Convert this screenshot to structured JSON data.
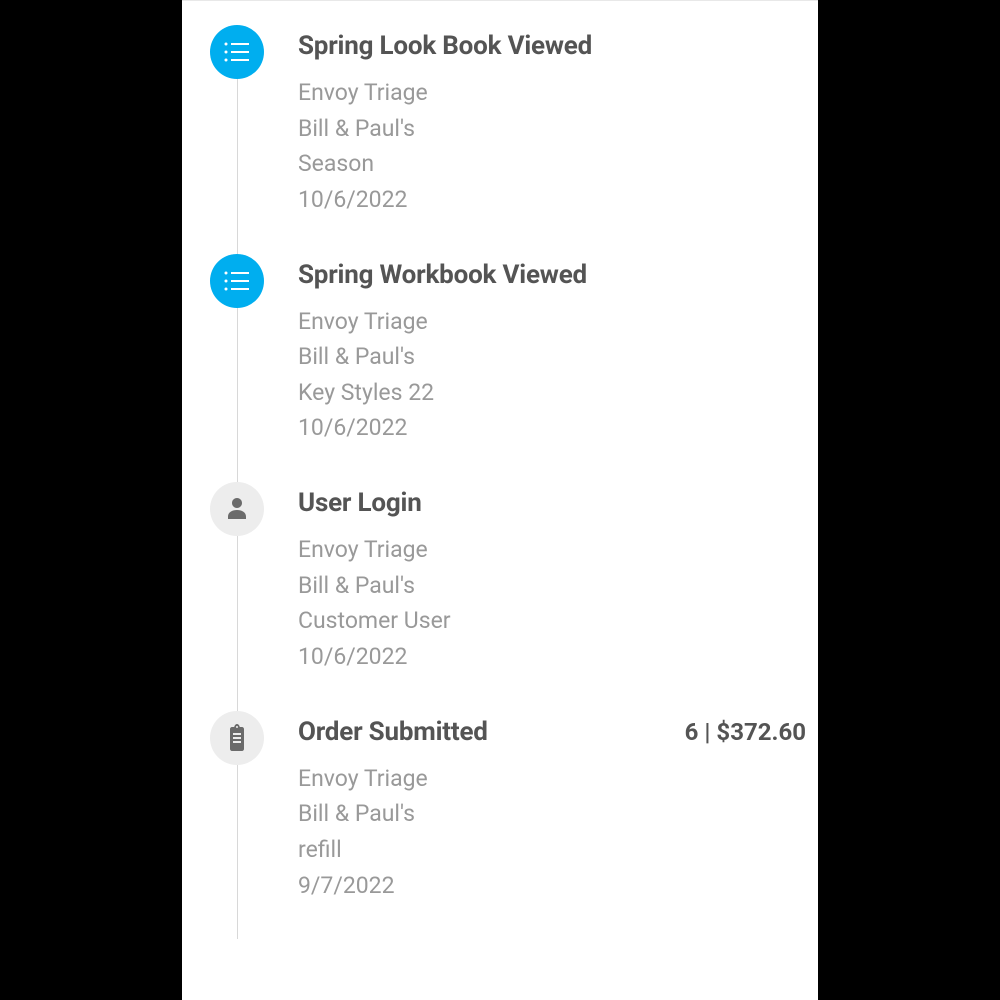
{
  "timeline": [
    {
      "iconType": "list",
      "iconColor": "blue",
      "title": "Spring Look Book Viewed",
      "meta": "",
      "lines": [
        "Envoy Triage",
        "Bill & Paul's",
        "Season",
        "10/6/2022"
      ]
    },
    {
      "iconType": "list",
      "iconColor": "blue",
      "title": "Spring Workbook Viewed",
      "meta": "",
      "lines": [
        "Envoy Triage",
        "Bill & Paul's",
        "Key Styles  22",
        "10/6/2022"
      ]
    },
    {
      "iconType": "user",
      "iconColor": "gray",
      "title": "User Login",
      "meta": "",
      "lines": [
        "Envoy Triage",
        "Bill & Paul's",
        "Customer User",
        "10/6/2022"
      ]
    },
    {
      "iconType": "clipboard",
      "iconColor": "gray",
      "title": "Order Submitted",
      "meta": "6 | $372.60",
      "lines": [
        "Envoy Triage",
        "Bill & Paul's",
        "refill",
        "9/7/2022"
      ]
    }
  ]
}
